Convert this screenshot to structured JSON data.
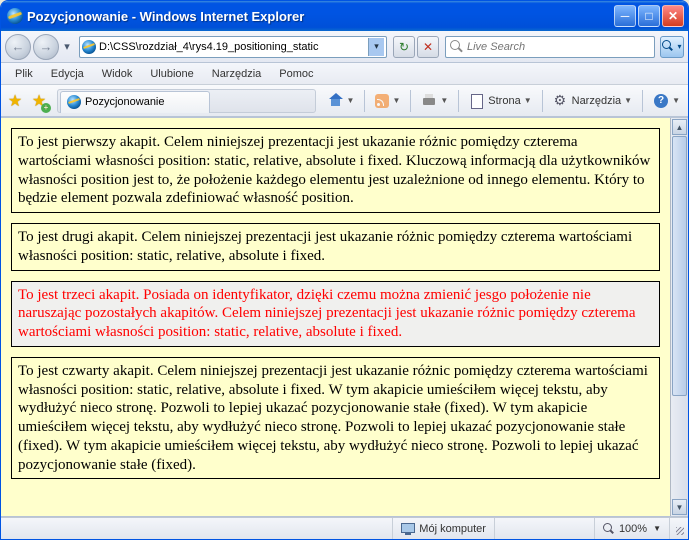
{
  "window": {
    "title": "Pozycjonowanie - Windows Internet Explorer"
  },
  "address": {
    "url": "D:\\CSS\\rozdział_4\\rys4.19_positioning_static"
  },
  "search": {
    "placeholder": "Live Search"
  },
  "menu": {
    "file": "Plik",
    "edit": "Edycja",
    "view": "Widok",
    "favorites": "Ulubione",
    "tools": "Narzędzia",
    "help": "Pomoc"
  },
  "tab": {
    "title": "Pozycjonowanie"
  },
  "toolbar": {
    "page": "Strona",
    "tools": "Narzędzia"
  },
  "paragraphs": {
    "p1": "To jest pierwszy akapit. Celem niniejszej prezentacji jest ukazanie różnic pomiędzy czterema wartościami własności position: static, relative, absolute i fixed. Kluczową informacją dla użytkowników własności position jest to, że położenie każdego elementu jest uzależnione od innego elementu. Który to będzie element pozwala zdefiniować własność position.",
    "p2": "To jest drugi akapit. Celem niniejszej prezentacji jest ukazanie różnic pomiędzy czterema wartościami własności position: static, relative, absolute i fixed.",
    "p3": "To jest trzeci akapit. Posiada on identyfikator, dzięki czemu można zmienić jesgo położenie nie naruszając pozostałych akapitów. Celem niniejszej prezentacji jest ukazanie różnic pomiędzy czterema wartościami własności position: static, relative, absolute i fixed.",
    "p4": "To jest czwarty akapit. Celem niniejszej prezentacji jest ukazanie różnic pomiędzy czterema wartościami własności position: static, relative, absolute i fixed. W tym akapicie umieściłem więcej tekstu, aby wydłużyć nieco stronę. Pozwoli to lepiej ukazać pozycjonowanie stałe (fixed). W tym akapicie umieściłem więcej tekstu, aby wydłużyć nieco stronę. Pozwoli to lepiej ukazać pozycjonowanie stałe (fixed). W tym akapicie umieściłem więcej tekstu, aby wydłużyć nieco stronę. Pozwoli to lepiej ukazać pozycjonowanie stałe (fixed)."
  },
  "status": {
    "zone": "Mój komputer",
    "zoom": "100%"
  }
}
